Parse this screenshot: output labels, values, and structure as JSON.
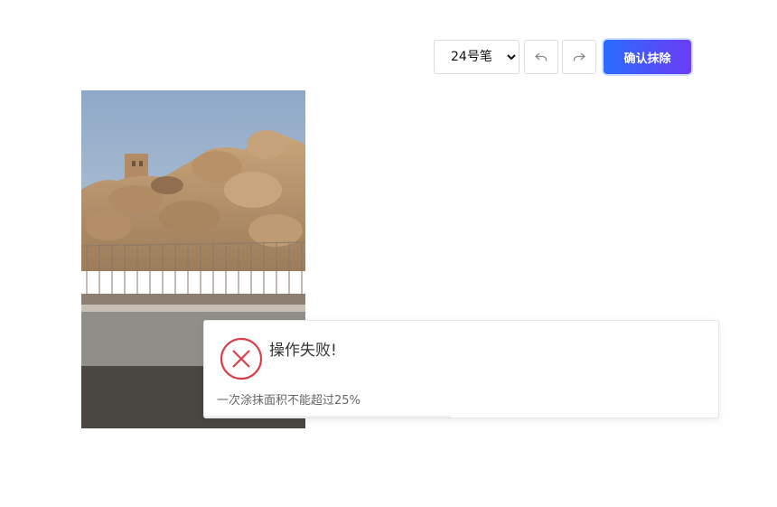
{
  "toolbar": {
    "brush_size": {
      "selected": "24号笔",
      "options": [
        "24号笔"
      ]
    },
    "undo_icon": "undo-arrow-icon",
    "redo_icon": "redo-arrow-icon",
    "confirm_label": "确认抹除",
    "accent_gradient": [
      "#2b6cff",
      "#6a3cf5"
    ]
  },
  "image": {
    "subject": "desert rock formation with fence and road"
  },
  "toast": {
    "icon": "error-circle-icon",
    "icon_color": "#d9414a",
    "title": "操作失败!",
    "message": "一次涂抹面积不能超过25%",
    "timer_progress": 0.48
  }
}
